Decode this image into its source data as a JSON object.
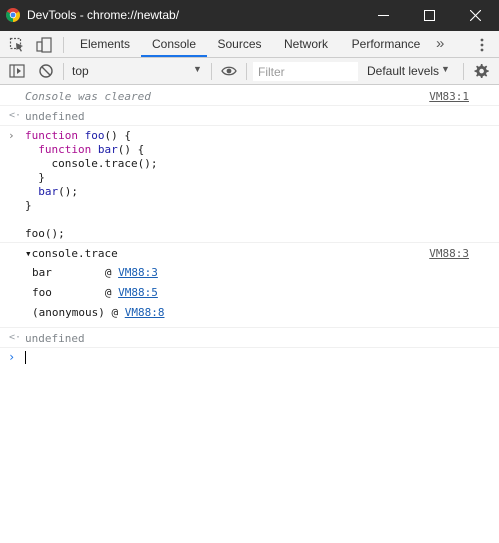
{
  "window": {
    "title": "DevTools - chrome://newtab/",
    "icon": "chrome-icon"
  },
  "tabs": [
    {
      "label": "Elements"
    },
    {
      "label": "Console"
    },
    {
      "label": "Sources"
    },
    {
      "label": "Network"
    },
    {
      "label": "Performance"
    }
  ],
  "more_tabs_glyph": "»",
  "console_toolbar": {
    "context": "top",
    "filter_placeholder": "Filter",
    "levels": "Default levels"
  },
  "messages": {
    "cleared": {
      "text": "Console was cleared",
      "source": "VM83:1"
    },
    "result1": "undefined",
    "code": {
      "line1_kw": "function",
      "line1_fn": "foo",
      "line1_rest": "() {",
      "line2_kw": "function",
      "line2_fn": "bar",
      "line2_rest": "() {",
      "line3": "    console.trace();",
      "line4": "  }",
      "line5_fn": "bar",
      "line5_rest": "();",
      "line6": "}",
      "line8": "foo();"
    },
    "trace": {
      "label": "console.trace",
      "source": "VM88:3",
      "frames": [
        {
          "fn": "bar        ",
          "link": "VM88:3"
        },
        {
          "fn": "foo        ",
          "link": "VM88:5"
        },
        {
          "fn": "(anonymous) ",
          "link": "VM88:8"
        }
      ]
    },
    "result2": "undefined"
  }
}
